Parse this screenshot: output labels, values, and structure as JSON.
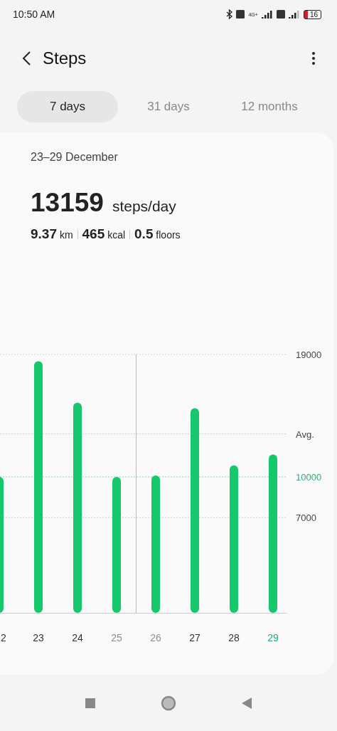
{
  "status_bar": {
    "time": "10:50 AM",
    "network": "4G+",
    "battery": "16"
  },
  "header": {
    "title": "Steps"
  },
  "tabs": [
    {
      "label": "7 days",
      "selected": true
    },
    {
      "label": "31 days",
      "selected": false
    },
    {
      "label": "12 months",
      "selected": false
    }
  ],
  "summary": {
    "range": "23–29 December",
    "value": "13159",
    "unit": "steps/day",
    "metrics": [
      {
        "value": "9.37",
        "unit": "km"
      },
      {
        "value": "465",
        "unit": "kcal"
      },
      {
        "value": "0.5",
        "unit": "floors"
      }
    ]
  },
  "chart_data": {
    "type": "bar",
    "categories": [
      "2",
      "23",
      "24",
      "25",
      "26",
      "27",
      "28",
      "29"
    ],
    "values": [
      10000,
      18500,
      15450,
      10000,
      10100,
      15050,
      10850,
      11650
    ],
    "ylim": [
      0,
      19000
    ],
    "ref_lines": [
      {
        "axis": "y",
        "value": 10000
      }
    ],
    "yticks": [
      {
        "value": 19000,
        "label": "19000"
      },
      {
        "value": 13159,
        "label": "Avg."
      },
      {
        "value": 10000,
        "label": "10000"
      },
      {
        "value": 7000,
        "label": "7000"
      }
    ]
  },
  "x_labels": [
    {
      "dimmed": false,
      "selected": false
    },
    {
      "dimmed": false,
      "selected": false
    },
    {
      "dimmed": false,
      "selected": false
    },
    {
      "dimmed": true,
      "selected": false
    },
    {
      "dimmed": true,
      "selected": false
    },
    {
      "dimmed": false,
      "selected": false
    },
    {
      "dimmed": false,
      "selected": false
    },
    {
      "dimmed": false,
      "selected": true
    }
  ]
}
